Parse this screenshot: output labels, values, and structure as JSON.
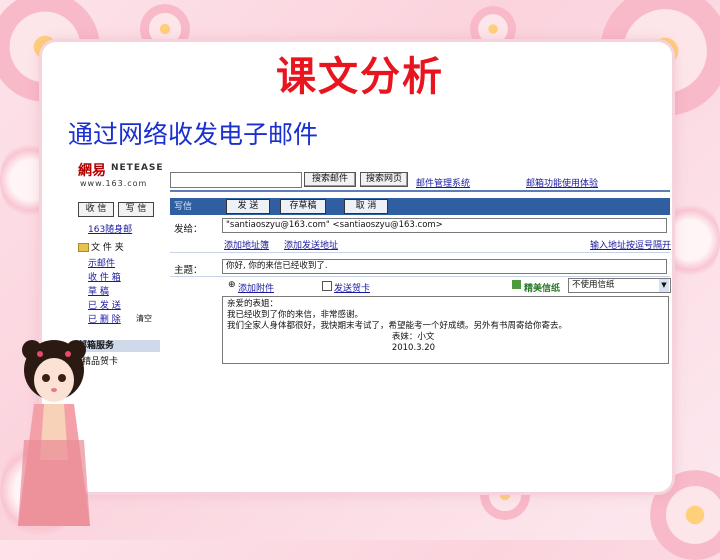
{
  "slide": {
    "title": "课文分析",
    "subtitle": "通过网络收发电子邮件"
  },
  "mail": {
    "logo": {
      "cn": "網易",
      "en": "NETEASE",
      "url": "www.163.com"
    },
    "header": {
      "search_btn_1": "搜索邮件",
      "search_btn_2": "搜索网页",
      "link_1": "邮件管理系统",
      "link_2": "邮箱功能使用体验"
    },
    "sidebar": {
      "receive_btn": "收 信",
      "write_btn": "写 信",
      "link_top": "163随身邮",
      "folder_head": "文 件 夹",
      "items": [
        "示邮件",
        "收 件 箱",
        "草      稿",
        "已 发 送",
        "已 删 除"
      ],
      "deleted_note": "清空",
      "section": "邮箱服务",
      "section_item": "精品贺卡"
    },
    "toolbar": {
      "write_tab": "写信",
      "send": "发 送",
      "save_draft": "存草稿",
      "cancel": "取 消"
    },
    "compose": {
      "to_label": "发给：",
      "to_value": "\"santiaoszyu@163.com\" <santiaoszyu@163.com>",
      "add_addr_link_1": "添加地址簿",
      "add_addr_link_2": "添加发送地址",
      "import_link": "输入地址按逗号隔开",
      "subject_label": "主题：",
      "subject_value": "你好, 你的来信已经收到了.",
      "attach_link": "添加附件",
      "card_link": "发送贺卡",
      "stationery_label": "精美信纸",
      "stationery_value": "不使用信纸",
      "body_lines": [
        "亲爱的表姐：",
        "    我已经收到了你的来信，非常感谢。",
        "    我们全家人身体都很好，我快期末考试了，希望能考一个好成绩。另外有书周寄给你寄去。",
        "                                                             表妹：小文",
        "                                                             2010.3.20"
      ]
    }
  },
  "colors": {
    "title": "#e8141e",
    "subtitle": "#1a2fd1",
    "accent": "#2f5fa0"
  }
}
